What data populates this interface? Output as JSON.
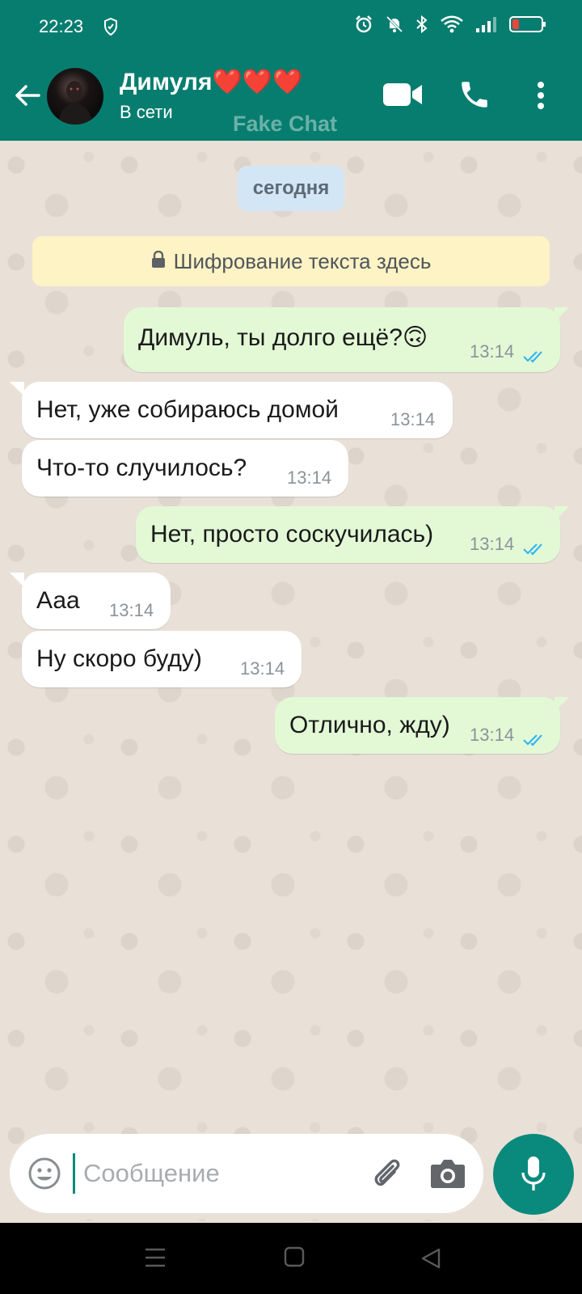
{
  "status_bar": {
    "time": "22:23"
  },
  "header": {
    "contact_name": "Димуля❤️❤️❤️",
    "contact_status": "В сети",
    "watermark": "Fake Chat"
  },
  "chat": {
    "date_chip": "сегодня",
    "encryption_notice": "Шифрование текста здесь",
    "messages": [
      {
        "direction": "out",
        "text": "Димуль, ты долго ещё?🙃",
        "time": "13:14",
        "read": true
      },
      {
        "direction": "in",
        "text": "Нет, уже собираюсь домой",
        "time": "13:14"
      },
      {
        "direction": "in",
        "text": "Что-то случилось?",
        "time": "13:14"
      },
      {
        "direction": "out",
        "text": "Нет, просто соскучилась)",
        "time": "13:14",
        "read": true
      },
      {
        "direction": "in",
        "text": "Ааа",
        "time": "13:14"
      },
      {
        "direction": "in",
        "text": "Ну скоро буду)",
        "time": "13:14"
      },
      {
        "direction": "out",
        "text": "Отлично, жду)",
        "time": "13:14",
        "read": true
      }
    ]
  },
  "composer": {
    "placeholder": "Сообщение"
  },
  "colors": {
    "header": "#077d6f",
    "outgoing_bubble": "#e3f9d6",
    "incoming_bubble": "#ffffff",
    "read_ticks": "#34b7f1",
    "mic_button": "#0a8a7d"
  }
}
